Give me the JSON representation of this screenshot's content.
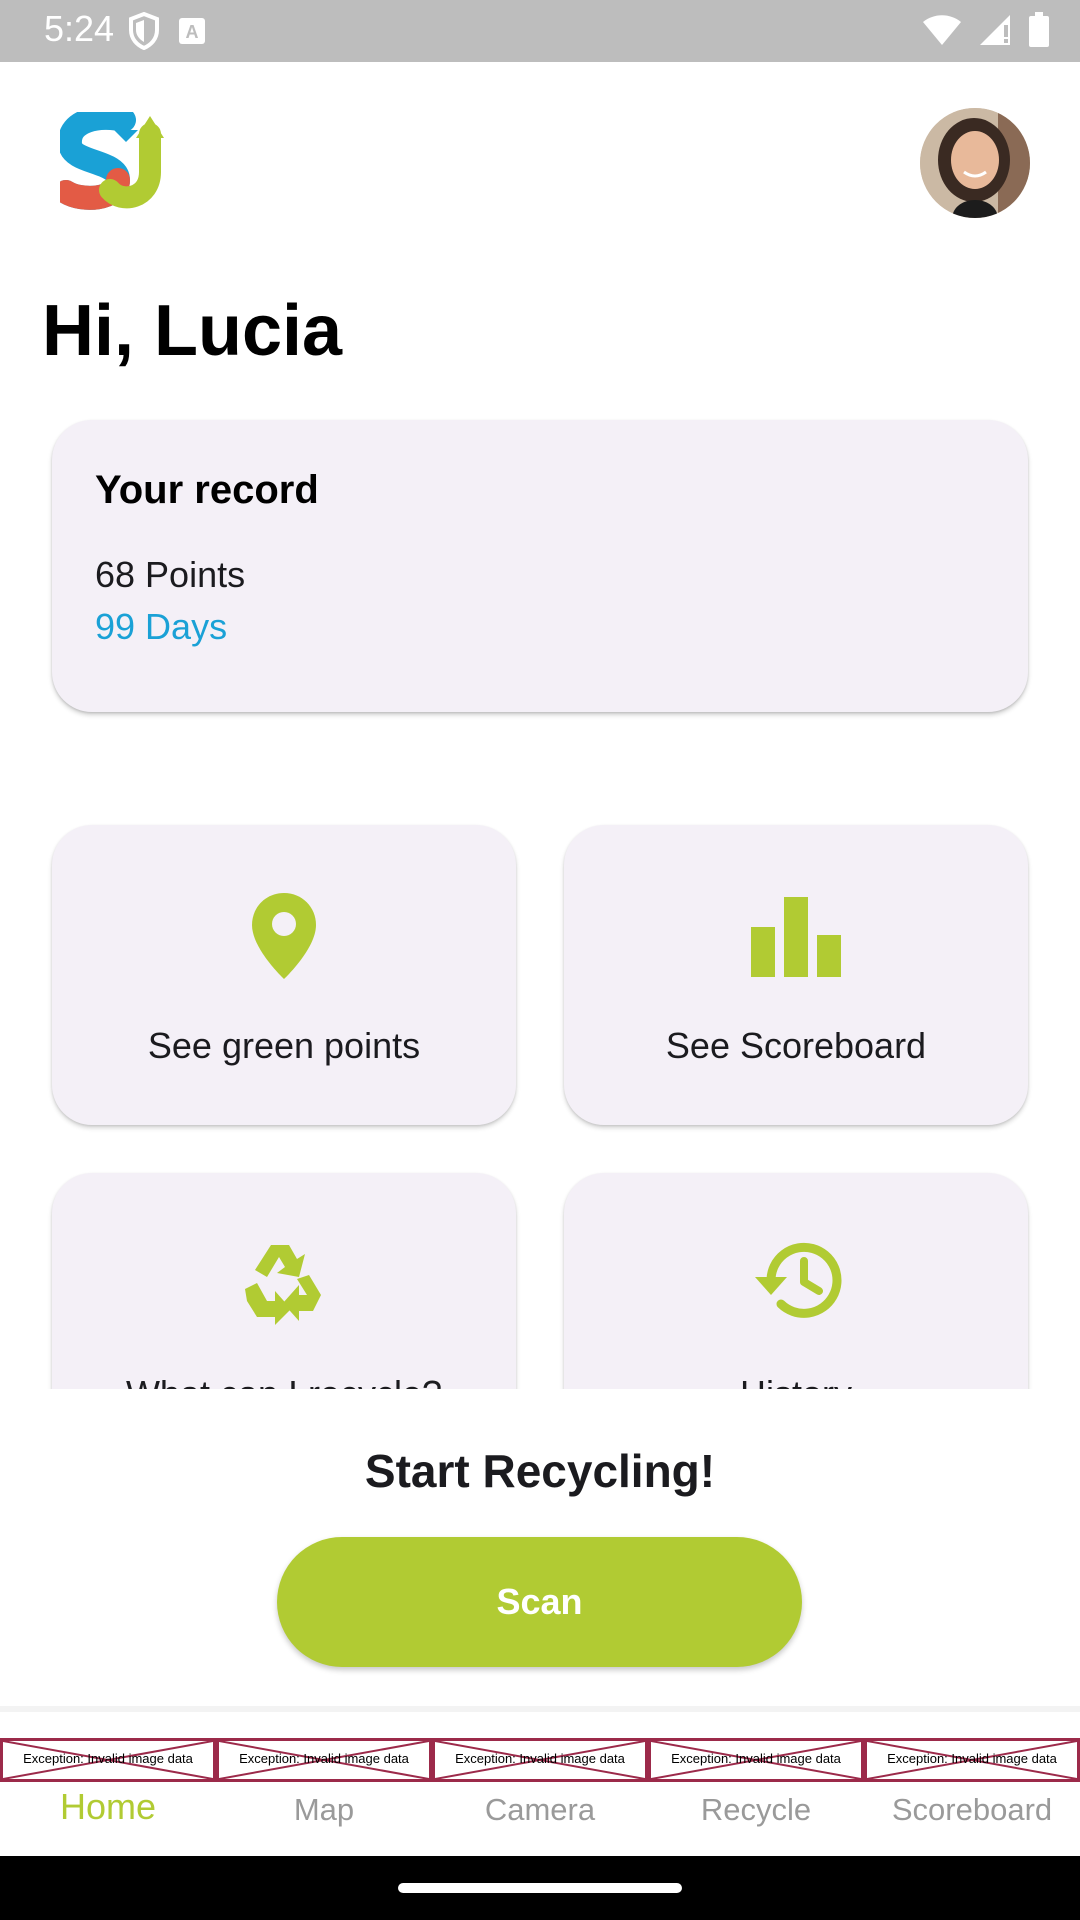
{
  "status_bar": {
    "time": "5:24",
    "icons": [
      "shield-icon",
      "a-badge-icon",
      "wifi-icon",
      "cell-signal-icon",
      "battery-icon"
    ]
  },
  "header": {
    "logo": "SJ",
    "greeting": "Hi, Lucia"
  },
  "record": {
    "title": "Your record",
    "points": "68 Points",
    "days": "99 Days"
  },
  "tiles": [
    {
      "label": "See green points",
      "icon": "map-pin-icon"
    },
    {
      "label": "See Scoreboard",
      "icon": "bar-chart-icon"
    },
    {
      "label": "What can I recycle?",
      "icon": "recycle-icon"
    },
    {
      "label": "History",
      "icon": "history-icon"
    }
  ],
  "cta": {
    "title": "Start Recycling!",
    "button": "Scan"
  },
  "bottom_nav": {
    "error_text": "Exception: Invalid image data",
    "items": [
      {
        "label": "Home",
        "active": true
      },
      {
        "label": "Map",
        "active": false
      },
      {
        "label": "Camera",
        "active": false
      },
      {
        "label": "Recycle",
        "active": false
      },
      {
        "label": "Scoreboard",
        "active": false
      }
    ]
  },
  "colors": {
    "accent_green": "#b1cb33",
    "accent_blue": "#1aa1d6",
    "card_bg": "#f4f0f7",
    "logo_red": "#e35b45"
  }
}
